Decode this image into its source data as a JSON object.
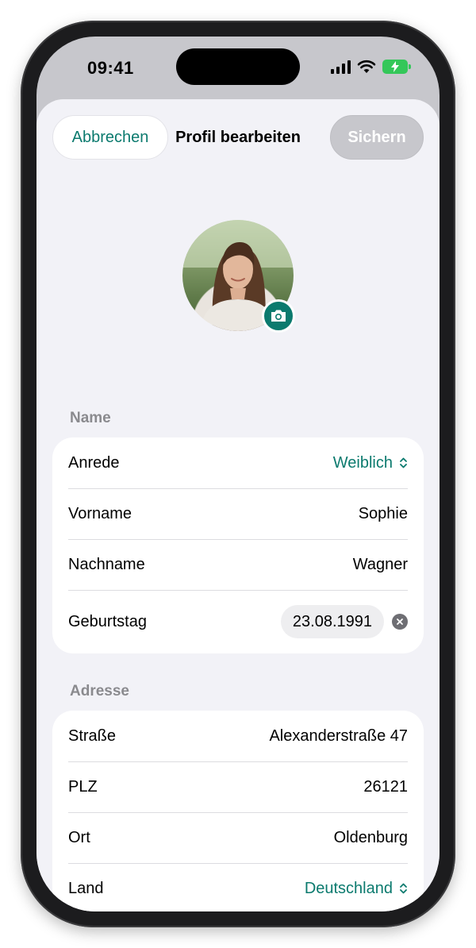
{
  "status": {
    "time": "09:41"
  },
  "nav": {
    "cancel_label": "Abbrechen",
    "title": "Profil bearbeiten",
    "save_label": "Sichern"
  },
  "name_section": {
    "header": "Name",
    "rows": [
      {
        "label": "Anrede",
        "value": "Weiblich"
      },
      {
        "label": "Vorname",
        "value": "Sophie"
      },
      {
        "label": "Nachname",
        "value": "Wagner"
      },
      {
        "label": "Geburtstag",
        "value": "23.08.1991"
      }
    ]
  },
  "address_section": {
    "header": "Adresse",
    "rows": [
      {
        "label": "Straße",
        "value": "Alexanderstraße 47"
      },
      {
        "label": "PLZ",
        "value": "26121"
      },
      {
        "label": "Ort",
        "value": "Oldenburg"
      },
      {
        "label": "Land",
        "value": "Deutschland"
      }
    ]
  },
  "colors": {
    "accent": "#0b7a6e",
    "background": "#f2f2f7",
    "disabled_button": "#c7c7cc"
  },
  "icons": {
    "camera": "camera-icon",
    "clear": "clear-icon",
    "chevron": "chevron-up-down-icon"
  }
}
